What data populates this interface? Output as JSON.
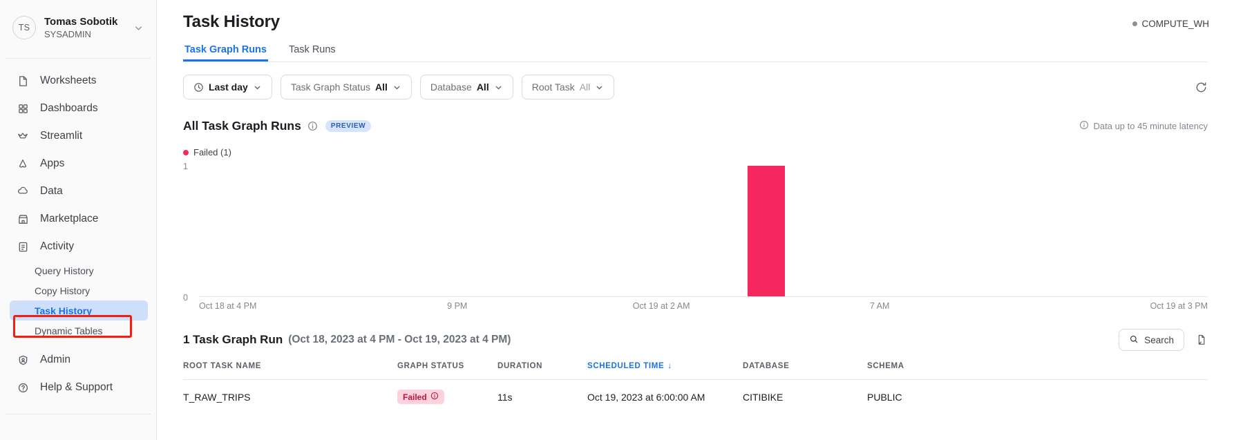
{
  "sidebar": {
    "account": {
      "initials": "TS",
      "name": "Tomas Sobotik",
      "role": "SYSADMIN",
      "chevron_icon": "chevron-down-icon"
    },
    "nav": [
      {
        "label": "Worksheets",
        "icon": "document-icon"
      },
      {
        "label": "Dashboards",
        "icon": "grid-icon"
      },
      {
        "label": "Streamlit",
        "icon": "crown-icon"
      },
      {
        "label": "Apps",
        "icon": "apps-icon"
      },
      {
        "label": "Data",
        "icon": "cloud-icon"
      },
      {
        "label": "Marketplace",
        "icon": "store-icon"
      },
      {
        "label": "Activity",
        "icon": "activity-icon"
      }
    ],
    "sub_items": [
      {
        "label": "Query History",
        "active": false
      },
      {
        "label": "Copy History",
        "active": false
      },
      {
        "label": "Task History",
        "active": true
      },
      {
        "label": "Dynamic Tables",
        "active": false
      }
    ],
    "nav_bottom": [
      {
        "label": "Admin",
        "icon": "admin-icon"
      },
      {
        "label": "Help & Support",
        "icon": "help-icon"
      }
    ],
    "highlight_color": "#f41d0f"
  },
  "header": {
    "title": "Task History",
    "warehouse": "COMPUTE_WH"
  },
  "tabs": [
    {
      "label": "Task Graph Runs",
      "active": true
    },
    {
      "label": "Task Runs",
      "active": false
    }
  ],
  "filters": {
    "time_range": {
      "label": "",
      "value": "Last day",
      "icon": "clock-icon"
    },
    "task_graph_status": {
      "label": "Task Graph Status",
      "value": "All"
    },
    "database": {
      "label": "Database",
      "value": "All"
    },
    "root_task": {
      "label": "Root Task",
      "value": "All"
    },
    "refresh_icon": "refresh-icon"
  },
  "chart_panel": {
    "title": "All Task Graph Runs",
    "info_icon": "info-icon",
    "badge": "PREVIEW",
    "latency_note": "Data up to 45 minute latency",
    "latency_icon": "info-icon"
  },
  "chart_data": {
    "type": "bar",
    "title": "All Task Graph Runs",
    "xlabel": "",
    "ylabel": "",
    "ylim": [
      0,
      1
    ],
    "y_ticks": [
      "0",
      "1"
    ],
    "grid": false,
    "legend_position": "top-left",
    "legend": [
      {
        "name": "Failed (1)",
        "color": "#f6275e"
      }
    ],
    "x_tick_labels": [
      "Oct 18 at 4 PM",
      "9 PM",
      "Oct 19 at 2 AM",
      "7 AM",
      "Oct 19 at 3 PM"
    ],
    "x_tick_positions_pct": [
      0,
      24.6,
      43.0,
      66.5,
      100
    ],
    "series": [
      {
        "name": "Failed",
        "color": "#f6275e",
        "bars": [
          {
            "x_label": "Oct 19 at 6:00 AM",
            "value": 1,
            "left_pct": 54.4,
            "width_pct": 3.7
          }
        ]
      }
    ]
  },
  "results": {
    "count_label": "1 Task Graph Run",
    "range_label": "(Oct 18, 2023 at 4 PM - Oct 19, 2023 at 4 PM)",
    "search_label": "Search",
    "search_icon": "search-icon",
    "export_icon": "export-icon"
  },
  "table": {
    "columns": [
      {
        "key": "root_task_name",
        "label": "ROOT TASK NAME",
        "sorted": false
      },
      {
        "key": "graph_status",
        "label": "GRAPH STATUS",
        "sorted": false
      },
      {
        "key": "duration",
        "label": "DURATION",
        "sorted": false
      },
      {
        "key": "scheduled_time",
        "label": "SCHEDULED TIME",
        "sorted": true,
        "sort_arrow": "↓"
      },
      {
        "key": "database",
        "label": "DATABASE",
        "sorted": false
      },
      {
        "key": "schema",
        "label": "SCHEMA",
        "sorted": false
      }
    ],
    "rows": [
      {
        "root_task_name": "T_RAW_TRIPS",
        "graph_status": "Failed",
        "status_info_icon": "info-icon",
        "duration": "11s",
        "scheduled_time": "Oct 19, 2023 at 6:00:00 AM",
        "database": "CITIBIKE",
        "schema": "PUBLIC"
      }
    ]
  },
  "colors": {
    "accent": "#1a73e8",
    "failed": "#f6275e",
    "failed_chip_bg": "#fbd2dd",
    "failed_chip_text": "#c1123f",
    "annotation": "#f41d0f"
  }
}
